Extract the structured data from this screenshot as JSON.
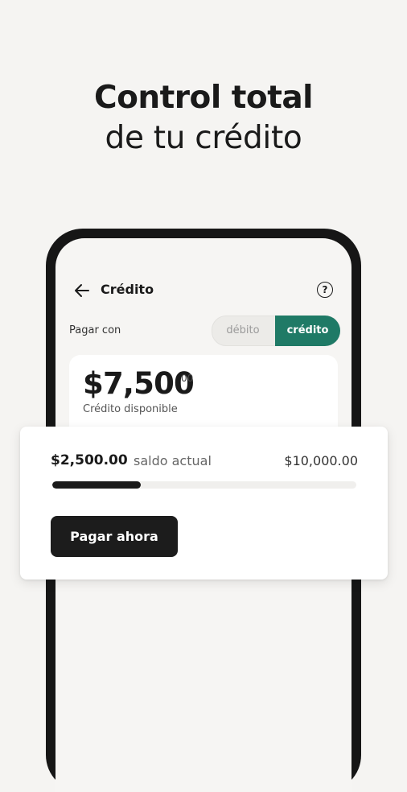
{
  "headline": {
    "line1": "Control total",
    "line2": "de tu crédito"
  },
  "app": {
    "title": "Crédito",
    "help_glyph": "?",
    "icons": {
      "back": "arrow-left-icon",
      "help": "question-circle-icon"
    }
  },
  "pay_with": {
    "label": "Pagar con",
    "options": [
      "débito",
      "crédito"
    ],
    "selected": "crédito"
  },
  "balance": {
    "amount": "$7,500",
    "cents": "00",
    "label": "Crédito disponible"
  },
  "usage": {
    "current_amount": "$2,500.00",
    "current_label": "saldo actual",
    "limit": "$10,000.00",
    "progress_fraction": 0.29
  },
  "actions": {
    "pay_now": "Pagar ahora"
  },
  "colors": {
    "accent": "#1f7a66",
    "dark": "#1a1a1a",
    "background": "#f5f4f2"
  }
}
